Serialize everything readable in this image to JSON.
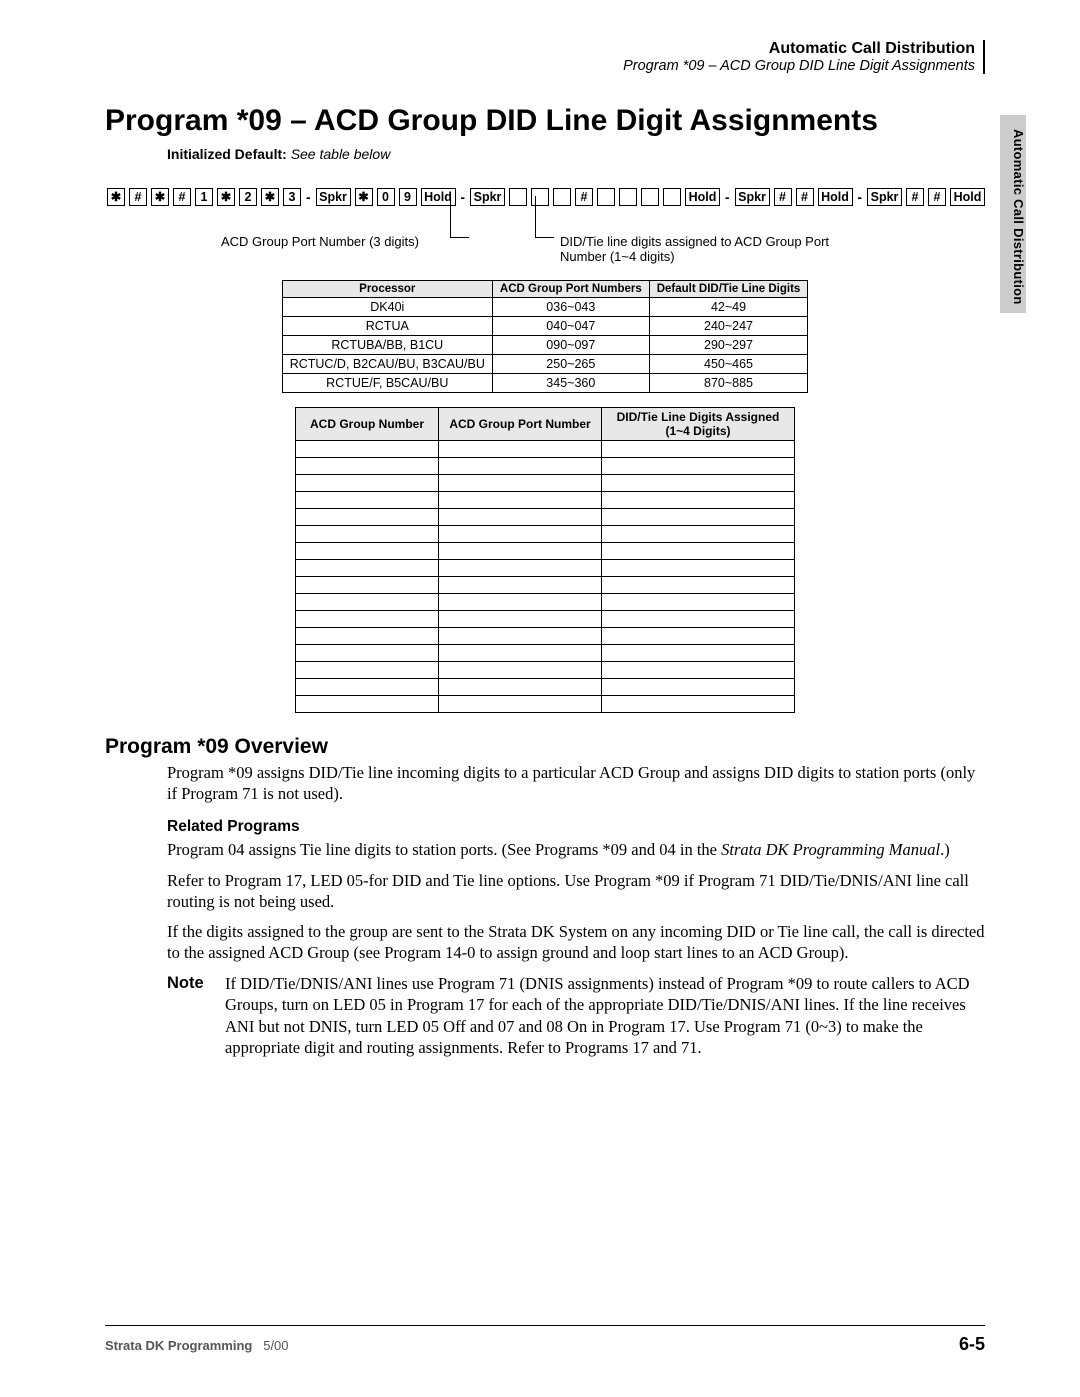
{
  "header": {
    "title": "Automatic Call Distribution",
    "subtitle": "Program *09 – ACD Group DID Line Digit Assignments"
  },
  "side_tab": "Automatic Call Distribution",
  "page_title": "Program *09 – ACD Group DID Line Digit Assignments",
  "init_default": {
    "label": "Initialized Default:",
    "value": "See table below"
  },
  "keyseq": {
    "k1": "✱",
    "k2": "#",
    "k3": "✱",
    "k4": "#",
    "k5": "1",
    "k6": "✱",
    "k7": "2",
    "k8": "✱",
    "k9": "3",
    "dash": "-",
    "spkr": "Spkr",
    "kstar": "✱",
    "k0": "0",
    "k9b": "9",
    "hold": "Hold",
    "hash": "#"
  },
  "callouts": {
    "left": "ACD Group Port Number (3 digits)",
    "right": "DID/Tie line digits assigned to ACD Group Port Number (1~4 digits)"
  },
  "proc_table": {
    "headers": [
      "Processor",
      "ACD Group Port Numbers",
      "Default DID/Tie Line Digits"
    ],
    "rows": [
      [
        "DK40i",
        "036~043",
        "42~49"
      ],
      [
        "RCTUA",
        "040~047",
        "240~247"
      ],
      [
        "RCTUBA/BB, B1CU",
        "090~097",
        "290~297"
      ],
      [
        "RCTUC/D, B2CAU/BU, B3CAU/BU",
        "250~265",
        "450~465"
      ],
      [
        "RCTUE/F, B5CAU/BU",
        "345~360",
        "870~885"
      ]
    ]
  },
  "blank_table": {
    "headers": [
      "ACD Group Number",
      "ACD Group Port Number",
      "DID/Tie Line Digits Assigned (1~4 Digits)"
    ],
    "row_count": 16
  },
  "overview": {
    "heading": "Program *09 Overview",
    "p1": "Program *09 assigns DID/Tie line incoming digits to a particular ACD Group and assigns DID digits to station ports (only if Program 71 is not used)."
  },
  "related": {
    "heading": "Related Programs",
    "p1a": "Program 04 assigns Tie line digits to station ports. (See Programs *09 and 04 in the ",
    "p1b": "Strata DK Programming Manual",
    "p1c": ".)",
    "p2": "Refer to Program 17, LED 05-for DID and Tie line options. Use Program *09 if Program 71 DID/Tie/DNIS/ANI line call routing is not being used.",
    "p3": "If the digits assigned to the group are sent to the Strata DK System on any incoming DID or Tie line call, the call is directed to the assigned ACD Group (see Program 14-0 to assign ground and loop start lines to an ACD Group).",
    "note_label": "Note",
    "note": "If DID/Tie/DNIS/ANI lines use Program 71 (DNIS assignments) instead of Program *09 to route callers to ACD Groups, turn on LED 05 in Program 17 for each of the appropriate DID/Tie/DNIS/ANI lines. If the line receives ANI but not DNIS, turn LED 05 Off and 07 and 08 On in Program 17. Use Program 71 (0~3) to make the appropriate digit and routing assignments. Refer to Programs 17 and 71."
  },
  "footer": {
    "left_bold": "Strata DK Programming",
    "left_date": "5/00",
    "right": "6-5"
  }
}
